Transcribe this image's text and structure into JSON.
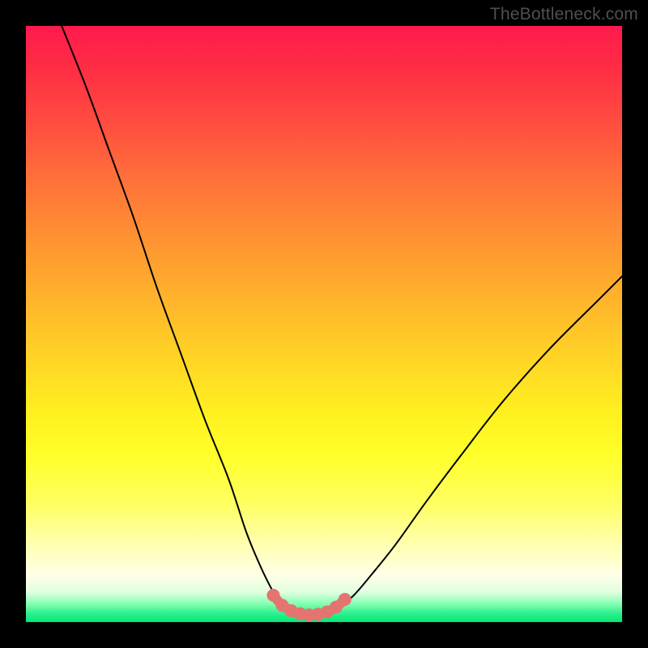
{
  "watermark": "TheBottleneck.com",
  "colors": {
    "background": "#000000",
    "watermark_text": "#4f4f4f",
    "marker": "#e4746f",
    "curve": "#000000",
    "gradient_top": "#ff1a4d",
    "gradient_bottom": "#00e874"
  },
  "chart_data": {
    "type": "line",
    "title": "",
    "xlabel": "",
    "ylabel": "",
    "xlim": [
      0,
      100
    ],
    "ylim": [
      0,
      100
    ],
    "series": [
      {
        "name": "left-curve",
        "x": [
          6,
          10,
          14,
          18,
          22,
          26,
          30,
          34,
          37,
          39.5,
          41.5,
          43
        ],
        "y": [
          100,
          90,
          79,
          68,
          56,
          45,
          34,
          24,
          15,
          9,
          5,
          2.5
        ]
      },
      {
        "name": "valley-floor",
        "x": [
          43,
          45,
          47,
          49,
          51,
          52.5
        ],
        "y": [
          2.5,
          1.5,
          1.2,
          1.2,
          1.6,
          2.4
        ]
      },
      {
        "name": "right-curve",
        "x": [
          52.5,
          55,
          58,
          62,
          67,
          73,
          80,
          88,
          96,
          100
        ],
        "y": [
          2.4,
          4.5,
          8,
          13,
          20,
          28,
          37,
          46,
          54,
          58
        ]
      }
    ],
    "markers": {
      "name": "optimal-zone",
      "x": [
        41.5,
        43,
        44.5,
        46,
        47.5,
        49,
        50.5,
        52,
        53.5
      ],
      "y": [
        4.5,
        2.8,
        1.9,
        1.4,
        1.2,
        1.3,
        1.7,
        2.5,
        3.8
      ]
    }
  }
}
